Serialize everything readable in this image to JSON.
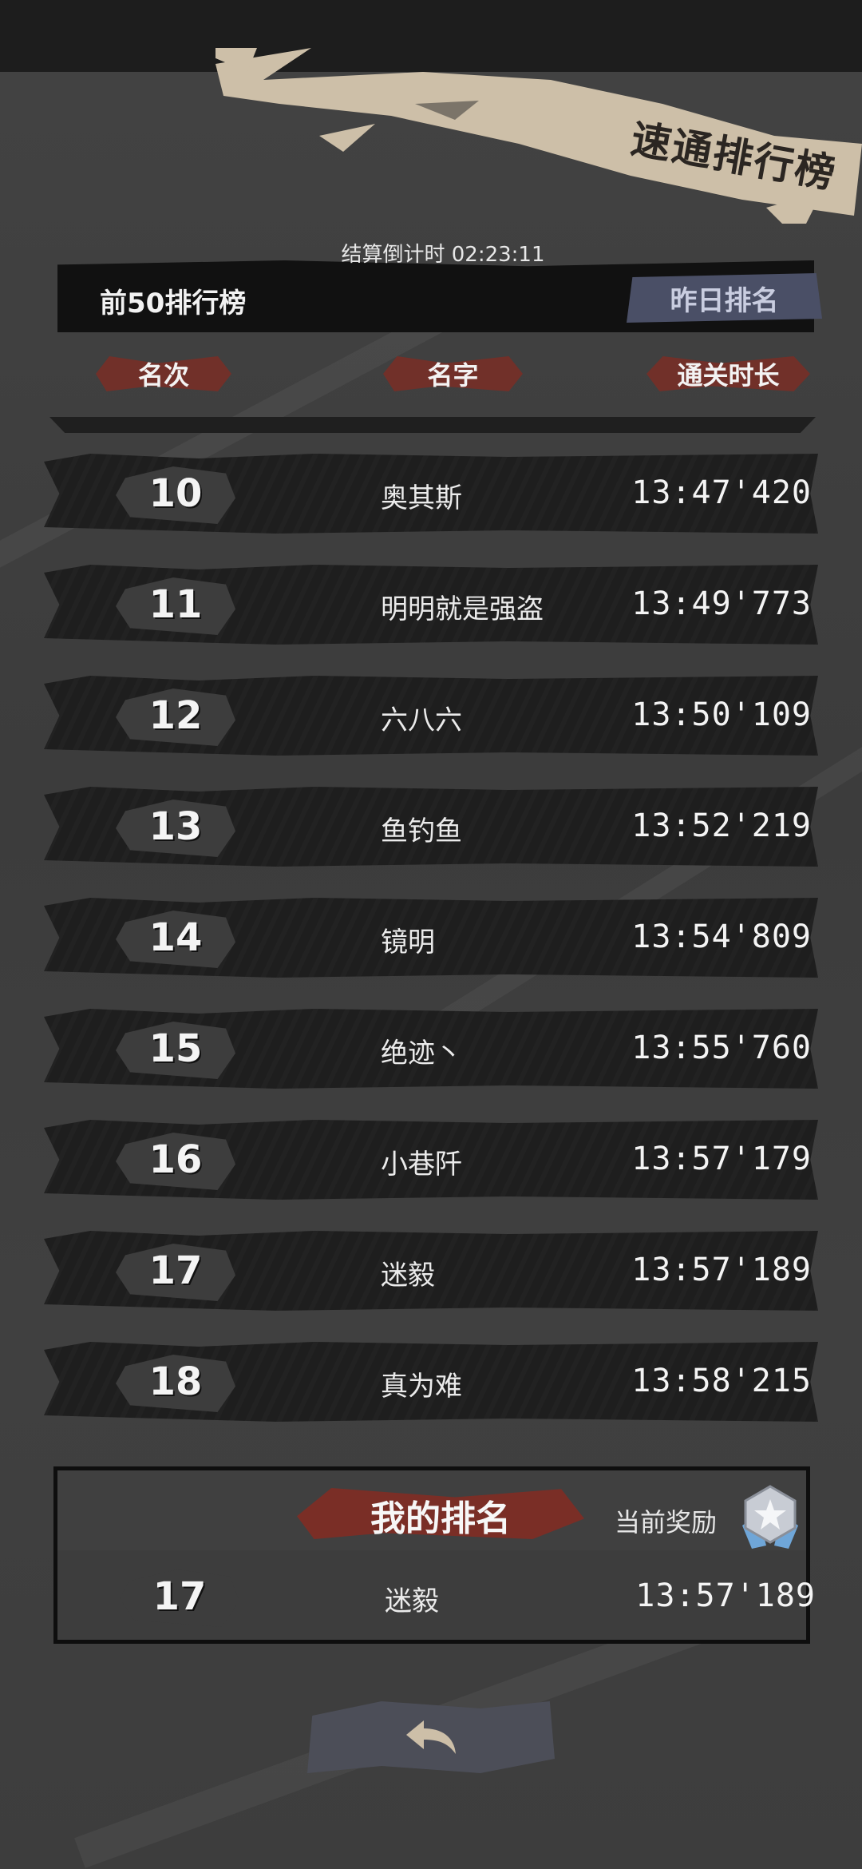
{
  "title": "速通排行榜",
  "countdown": "结算倒计时 02:23:11",
  "board_label": "前50排行榜",
  "yesterday_button": "昨日排名",
  "columns": {
    "rank": "名次",
    "name": "名字",
    "time": "通关时长"
  },
  "entries": [
    {
      "rank": "10",
      "name": "奥其斯",
      "time": "13:47'420"
    },
    {
      "rank": "11",
      "name": "明明就是强盗",
      "time": "13:49'773"
    },
    {
      "rank": "12",
      "name": "六八六",
      "time": "13:50'109"
    },
    {
      "rank": "13",
      "name": "鱼钓鱼",
      "time": "13:52'219"
    },
    {
      "rank": "14",
      "name": "镜明",
      "time": "13:54'809"
    },
    {
      "rank": "15",
      "name": "绝迹丶",
      "time": "13:55'760"
    },
    {
      "rank": "16",
      "name": "小巷阡",
      "time": "13:57'179"
    },
    {
      "rank": "17",
      "name": "迷毅",
      "time": "13:57'189"
    },
    {
      "rank": "18",
      "name": "真为难",
      "time": "13:58'215"
    }
  ],
  "my_rank": {
    "heading": "我的排名",
    "reward_label": "当前奖励",
    "reward_icon": "silver-star-medal-icon",
    "rank": "17",
    "name": "迷毅",
    "time": "13:57'189"
  },
  "back_icon": "back-arrow-icon",
  "colors": {
    "accent_red": "#7a2e26",
    "banner_beige": "#cdbfa8",
    "button_blue": "#4a4f66"
  }
}
